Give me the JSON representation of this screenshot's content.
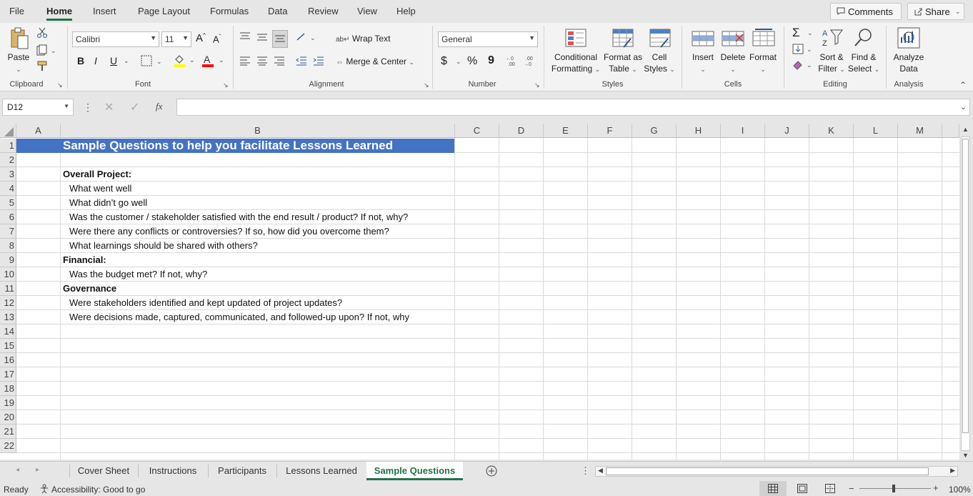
{
  "menu": {
    "tabs": [
      "File",
      "Home",
      "Insert",
      "Page Layout",
      "Formulas",
      "Data",
      "Review",
      "View",
      "Help"
    ],
    "comments": "Comments",
    "share": "Share"
  },
  "ribbon": {
    "clipboard": {
      "paste": "Paste",
      "label": "Clipboard"
    },
    "font": {
      "name": "Calibri",
      "size": "11",
      "label": "Font",
      "bold": "B",
      "italic": "I",
      "underline": "U"
    },
    "alignment": {
      "wrap": "Wrap Text",
      "merge": "Merge & Center",
      "label": "Alignment"
    },
    "number": {
      "format": "General",
      "label": "Number",
      "dollar": "$",
      "percent": "%",
      "comma": "9"
    },
    "styles": {
      "conditional_1": "Conditional",
      "conditional_2": "Formatting",
      "format_table_1": "Format as",
      "format_table_2": "Table",
      "cell_styles_1": "Cell",
      "cell_styles_2": "Styles",
      "label": "Styles"
    },
    "cells": {
      "insert": "Insert",
      "delete": "Delete",
      "format": "Format",
      "label": "Cells"
    },
    "editing": {
      "sort_1": "Sort &",
      "sort_2": "Filter",
      "find_1": "Find &",
      "find_2": "Select",
      "label": "Editing",
      "sigma": "Σ"
    },
    "analysis": {
      "analyze_1": "Analyze",
      "analyze_2": "Data",
      "label": "Analysis"
    }
  },
  "formula_bar": {
    "name_box": "D12",
    "fx": "fx",
    "value": ""
  },
  "colors": {
    "accent": "#217346",
    "title_fill": "#4472c4",
    "title_text": "#ffffff"
  },
  "grid": {
    "columns": [
      "A",
      "B",
      "C",
      "D",
      "E",
      "F",
      "G",
      "H",
      "I",
      "J",
      "K",
      "L",
      "M"
    ],
    "rows": [
      "1",
      "2",
      "3",
      "4",
      "5",
      "6",
      "7",
      "8",
      "9",
      "10",
      "11",
      "12",
      "13",
      "14",
      "15",
      "16",
      "17",
      "18",
      "19",
      "20",
      "21",
      "22"
    ],
    "title": "Sample Questions to help you facilitate Lessons Learned",
    "cells": [
      {
        "row": "3",
        "text": "Overall Project:",
        "bold": true,
        "indent": false
      },
      {
        "row": "4",
        "text": "What went well",
        "bold": false,
        "indent": true
      },
      {
        "row": "5",
        "text": "What didn’t go well",
        "bold": false,
        "indent": true
      },
      {
        "row": "6",
        "text": "Was the customer / stakeholder satisfied with the end result / product?  If not, why?",
        "bold": false,
        "indent": true
      },
      {
        "row": "7",
        "text": "Were there any conflicts or controversies?  If so, how did you overcome them?",
        "bold": false,
        "indent": true
      },
      {
        "row": "8",
        "text": "What learnings should be shared with others?",
        "bold": false,
        "indent": true
      },
      {
        "row": "9",
        "text": "Financial:",
        "bold": true,
        "indent": false
      },
      {
        "row": "10",
        "text": "Was the budget met?  If not, why?",
        "bold": false,
        "indent": true
      },
      {
        "row": "11",
        "text": "Governance",
        "bold": true,
        "indent": false
      },
      {
        "row": "12",
        "text": "Were stakeholders identified and kept updated of project updates?",
        "bold": false,
        "indent": true
      },
      {
        "row": "13",
        "text": "Were decisions made, captured, communicated, and followed-up upon?  If not, why",
        "bold": false,
        "indent": true
      }
    ]
  },
  "sheets": {
    "tabs": [
      "Cover Sheet",
      "Instructions",
      "Participants",
      "Lessons Learned",
      "Sample Questions"
    ],
    "active": "Sample Questions"
  },
  "status": {
    "ready": "Ready",
    "accessibility": "Accessibility: Good to go",
    "zoom": "100%"
  }
}
